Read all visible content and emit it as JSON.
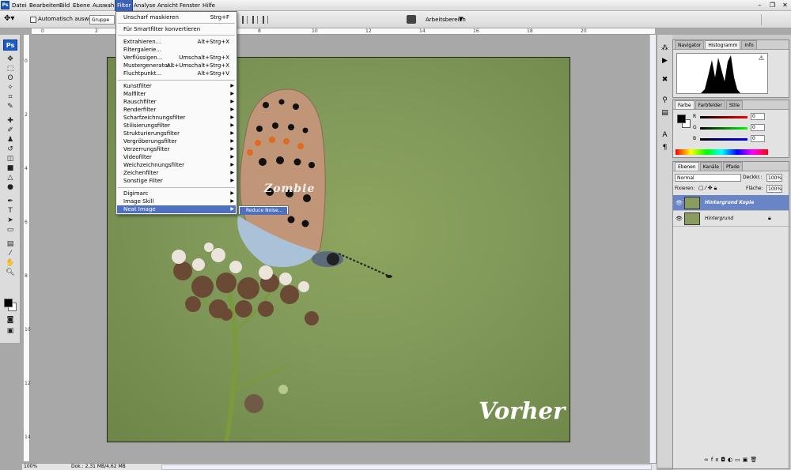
{
  "menubar": {
    "items": [
      "Datei",
      "Bearbeiten",
      "Bild",
      "Ebene",
      "Auswahl",
      "Filter",
      "Analyse",
      "Ansicht",
      "Fenster",
      "Hilfe"
    ],
    "active": "Filter"
  },
  "options": {
    "auto_select_label": "Automatisch auswählen:",
    "auto_select_value": "Gruppe",
    "workspace_label": "Arbeitsbereich"
  },
  "rulers": {
    "h": [
      "0",
      "2",
      "4",
      "6",
      "8",
      "10",
      "12",
      "14",
      "16",
      "18",
      "20"
    ],
    "v": [
      "0",
      "2",
      "4",
      "6",
      "8",
      "10",
      "12",
      "14"
    ]
  },
  "filter_menu": {
    "top": [
      {
        "label": "Unscharf maskieren",
        "shortcut": "Strg+F"
      },
      {
        "label": "Für Smartfilter konvertieren",
        "shortcut": ""
      }
    ],
    "group2": [
      {
        "label": "Extrahieren...",
        "shortcut": "Alt+Strg+X"
      },
      {
        "label": "Filtergalerie...",
        "shortcut": ""
      },
      {
        "label": "Verflüssigen...",
        "shortcut": "Umschalt+Strg+X"
      },
      {
        "label": "Mustergenerator...",
        "shortcut": "Alt+Umschalt+Strg+X"
      },
      {
        "label": "Fluchtpunkt...",
        "shortcut": "Alt+Strg+V"
      }
    ],
    "filters": [
      "Kunstfilter",
      "Malfilter",
      "Rauschfilter",
      "Renderfilter",
      "Scharfzeichnungsfilter",
      "Stilisierungsfilter",
      "Strukturierungsfilter",
      "Vergröberungsfilter",
      "Verzerrungsfilter",
      "Videofilter",
      "Weichzeichnungsfilter",
      "Zeichenfilter",
      "Sonstige Filter"
    ],
    "plugins": [
      "Digimarc",
      "Image Skill",
      "Neat Image"
    ],
    "highlighted": "Neat Image"
  },
  "submenu": {
    "item": "Reduce Noise..."
  },
  "canvas": {
    "watermark_top": "Zombie",
    "watermark_bottom": "Vorher"
  },
  "status": {
    "zoom": "100%",
    "doc": "Dok.: 2,31 MB/4,62 MB"
  },
  "panels": {
    "top_tabs": [
      "Navigator",
      "Histogramm",
      "Info"
    ],
    "color_tabs": [
      "Farbe",
      "Farbfelder",
      "Stile"
    ],
    "color": {
      "r_label": "R",
      "g_label": "G",
      "b_label": "B",
      "r": "0",
      "g": "0",
      "b": "0"
    },
    "layer_tabs": [
      "Ebenen",
      "Kanäle",
      "Pfade"
    ],
    "blend_mode": "Normal",
    "opacity_label": "Deckkr.:",
    "opacity": "100%",
    "lock_label": "Fixieren:",
    "fill_label": "Fläche:",
    "fill": "100%",
    "layers": [
      {
        "name": "Hintergrund Kopie",
        "selected": true
      },
      {
        "name": "Hintergrund",
        "selected": false
      }
    ]
  },
  "colors": {
    "accent": "#4f71bd",
    "background": "#a8a8a8",
    "photo_green": "#80985a"
  }
}
